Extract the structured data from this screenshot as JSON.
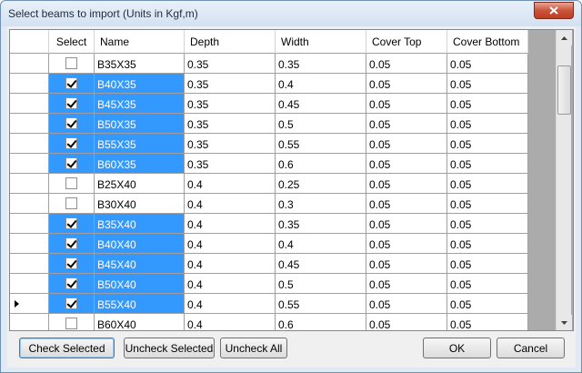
{
  "window": {
    "title": "Select beams to import (Units in Kgf,m)"
  },
  "grid": {
    "columns": [
      "Select",
      "Name",
      "Depth",
      "Width",
      "Cover Top",
      "Cover Bottom"
    ],
    "rows": [
      {
        "checked": false,
        "highlighted": false,
        "current": false,
        "name": "B35X35",
        "depth": "0.35",
        "width": "0.35",
        "cover_top": "0.05",
        "cover_bottom": "0.05"
      },
      {
        "checked": true,
        "highlighted": true,
        "current": false,
        "name": "B40X35",
        "depth": "0.35",
        "width": "0.4",
        "cover_top": "0.05",
        "cover_bottom": "0.05"
      },
      {
        "checked": true,
        "highlighted": true,
        "current": false,
        "name": "B45X35",
        "depth": "0.35",
        "width": "0.45",
        "cover_top": "0.05",
        "cover_bottom": "0.05"
      },
      {
        "checked": true,
        "highlighted": true,
        "current": false,
        "name": "B50X35",
        "depth": "0.35",
        "width": "0.5",
        "cover_top": "0.05",
        "cover_bottom": "0.05"
      },
      {
        "checked": true,
        "highlighted": true,
        "current": false,
        "name": "B55X35",
        "depth": "0.35",
        "width": "0.55",
        "cover_top": "0.05",
        "cover_bottom": "0.05"
      },
      {
        "checked": true,
        "highlighted": true,
        "current": false,
        "name": "B60X35",
        "depth": "0.35",
        "width": "0.6",
        "cover_top": "0.05",
        "cover_bottom": "0.05"
      },
      {
        "checked": false,
        "highlighted": false,
        "current": false,
        "name": "B25X40",
        "depth": "0.4",
        "width": "0.25",
        "cover_top": "0.05",
        "cover_bottom": "0.05"
      },
      {
        "checked": false,
        "highlighted": false,
        "current": false,
        "name": "B30X40",
        "depth": "0.4",
        "width": "0.3",
        "cover_top": "0.05",
        "cover_bottom": "0.05"
      },
      {
        "checked": true,
        "highlighted": true,
        "current": false,
        "name": "B35X40",
        "depth": "0.4",
        "width": "0.35",
        "cover_top": "0.05",
        "cover_bottom": "0.05"
      },
      {
        "checked": true,
        "highlighted": true,
        "current": false,
        "name": "B40X40",
        "depth": "0.4",
        "width": "0.4",
        "cover_top": "0.05",
        "cover_bottom": "0.05"
      },
      {
        "checked": true,
        "highlighted": true,
        "current": false,
        "name": "B45X40",
        "depth": "0.4",
        "width": "0.45",
        "cover_top": "0.05",
        "cover_bottom": "0.05"
      },
      {
        "checked": true,
        "highlighted": true,
        "current": false,
        "name": "B50X40",
        "depth": "0.4",
        "width": "0.5",
        "cover_top": "0.05",
        "cover_bottom": "0.05"
      },
      {
        "checked": true,
        "highlighted": true,
        "current": true,
        "name": "B55X40",
        "depth": "0.4",
        "width": "0.55",
        "cover_top": "0.05",
        "cover_bottom": "0.05"
      },
      {
        "checked": false,
        "highlighted": false,
        "current": false,
        "name": "B60X40",
        "depth": "0.4",
        "width": "0.6",
        "cover_top": "0.05",
        "cover_bottom": "0.05"
      }
    ],
    "scroll_position": 0.12
  },
  "buttons": {
    "check_selected": "Check Selected",
    "uncheck_selected": "Uncheck Selected",
    "uncheck_all": "Uncheck All",
    "ok": "OK",
    "cancel": "Cancel"
  },
  "colors": {
    "selection": "#3399ff",
    "close_button": "#c9553a",
    "title_bar": "#dfeaf6"
  },
  "icons": {
    "close": "close-icon",
    "current_row": "row-pointer-icon",
    "scroll_up": "scroll-up-icon",
    "scroll_down": "scroll-down-icon"
  }
}
